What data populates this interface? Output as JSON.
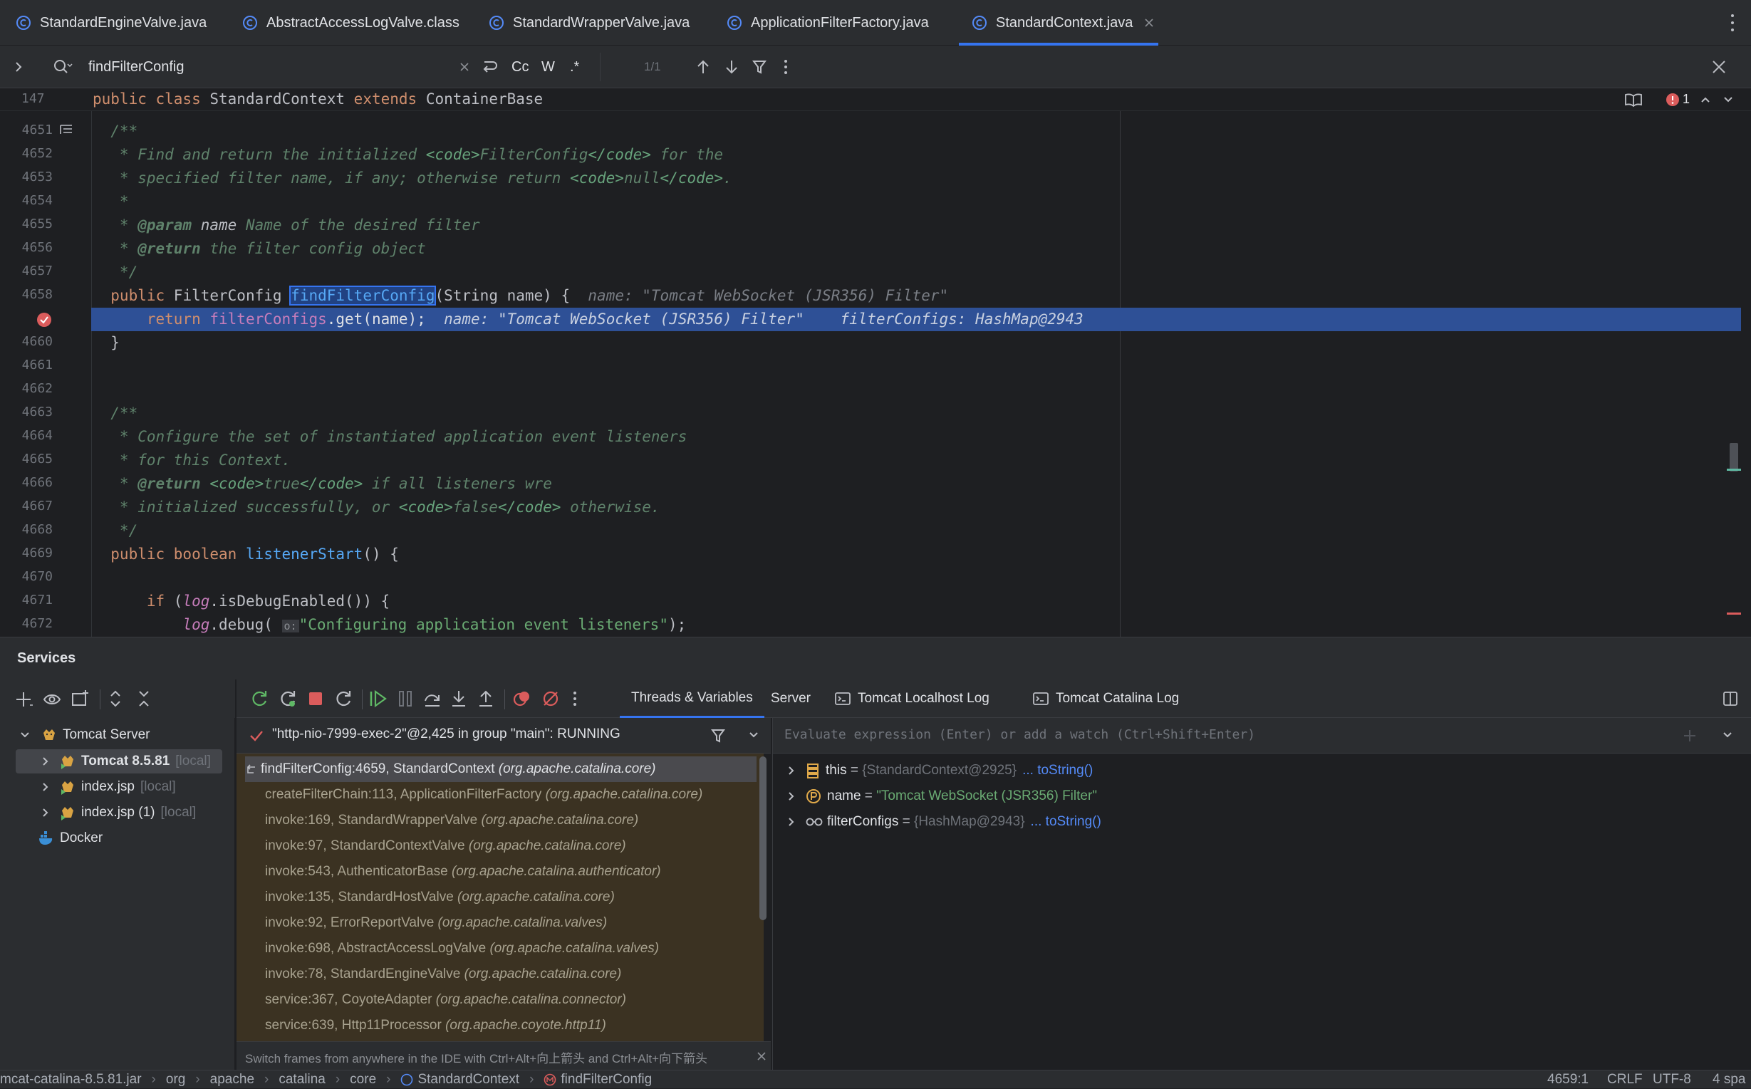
{
  "tabs": [
    {
      "label": "StandardEngineValve.java"
    },
    {
      "label": "AbstractAccessLogValve.class"
    },
    {
      "label": "StandardWrapperValve.java"
    },
    {
      "label": "ApplicationFilterFactory.java"
    },
    {
      "label": "StandardContext.java"
    }
  ],
  "find": {
    "query": "findFilterConfig",
    "count": "1/1",
    "case_label": "Cc",
    "word_label": "W",
    "regex_label": ".*"
  },
  "structure": {
    "line_no": "147",
    "text": "public class StandardContext extends ContainerBase",
    "problems": "1"
  },
  "editor": {
    "lines": [
      "4651",
      "4652",
      "4653",
      "4654",
      "4655",
      "4656",
      "4657",
      "4658",
      "",
      "4660",
      "4661",
      "4662",
      "4663",
      "4664",
      "4665",
      "4666",
      "4667",
      "4668",
      "4669",
      "4670",
      "4671",
      "4672"
    ],
    "hint_name": "name: \"Tomcat WebSocket (JSR356) Filter\"",
    "hint_name2": "name: \"Tomcat WebSocket (JSR356) Filter\"",
    "hint_configs": "filterConfigs: HashMap@2943"
  },
  "services": {
    "title": "Services",
    "tree": [
      {
        "label": "Tomcat Server",
        "suffix": ""
      },
      {
        "label": "Tomcat 8.5.81",
        "suffix": "[local]"
      },
      {
        "label": "index.jsp",
        "suffix": "[local]"
      },
      {
        "label": "index.jsp (1)",
        "suffix": "[local]"
      },
      {
        "label": "Docker",
        "suffix": ""
      }
    ]
  },
  "debug": {
    "tabs": [
      "Threads & Variables",
      "Server",
      "Tomcat Localhost Log",
      "Tomcat Catalina Log"
    ],
    "thread": "\"http-nio-7999-exec-2\"@2,425 in group \"main\": RUNNING",
    "eval_placeholder": "Evaluate expression (Enter) or add a watch (Ctrl+Shift+Enter)",
    "frames": [
      {
        "method": "findFilterConfig:4659, StandardContext",
        "pkg": "(org.apache.catalina.core)"
      },
      {
        "method": "createFilterChain:113, ApplicationFilterFactory",
        "pkg": "(org.apache.catalina.core)"
      },
      {
        "method": "invoke:169, StandardWrapperValve",
        "pkg": "(org.apache.catalina.core)"
      },
      {
        "method": "invoke:97, StandardContextValve",
        "pkg": "(org.apache.catalina.core)"
      },
      {
        "method": "invoke:543, AuthenticatorBase",
        "pkg": "(org.apache.catalina.authenticator)"
      },
      {
        "method": "invoke:135, StandardHostValve",
        "pkg": "(org.apache.catalina.core)"
      },
      {
        "method": "invoke:92, ErrorReportValve",
        "pkg": "(org.apache.catalina.valves)"
      },
      {
        "method": "invoke:698, AbstractAccessLogValve",
        "pkg": "(org.apache.catalina.valves)"
      },
      {
        "method": "invoke:78, StandardEngineValve",
        "pkg": "(org.apache.catalina.core)"
      },
      {
        "method": "service:367, CoyoteAdapter",
        "pkg": "(org.apache.catalina.connector)"
      },
      {
        "method": "service:639, Http11Processor",
        "pkg": "(org.apache.coyote.http11)"
      }
    ],
    "frames_tip": "Switch frames from anywhere in the IDE with Ctrl+Alt+向上箭头 and Ctrl+Alt+向下箭头",
    "vars": [
      {
        "name": "this",
        "eq": " = ",
        "value": "{StandardContext@2925}",
        "link": "... toString()"
      },
      {
        "name": "name",
        "eq": " = ",
        "value": "\"Tomcat WebSocket (JSR356) Filter\"",
        "link": ""
      },
      {
        "name": "filterConfigs",
        "eq": " = ",
        "value": "{HashMap@2943}",
        "link": "... toString()"
      }
    ]
  },
  "status": {
    "path": [
      "mcat-catalina-8.5.81.jar",
      "org",
      "apache",
      "catalina",
      "core",
      "StandardContext",
      "findFilterConfig"
    ],
    "position": "4659:1",
    "line_sep": "CRLF",
    "encoding": "UTF-8",
    "indent": "4 spa"
  }
}
